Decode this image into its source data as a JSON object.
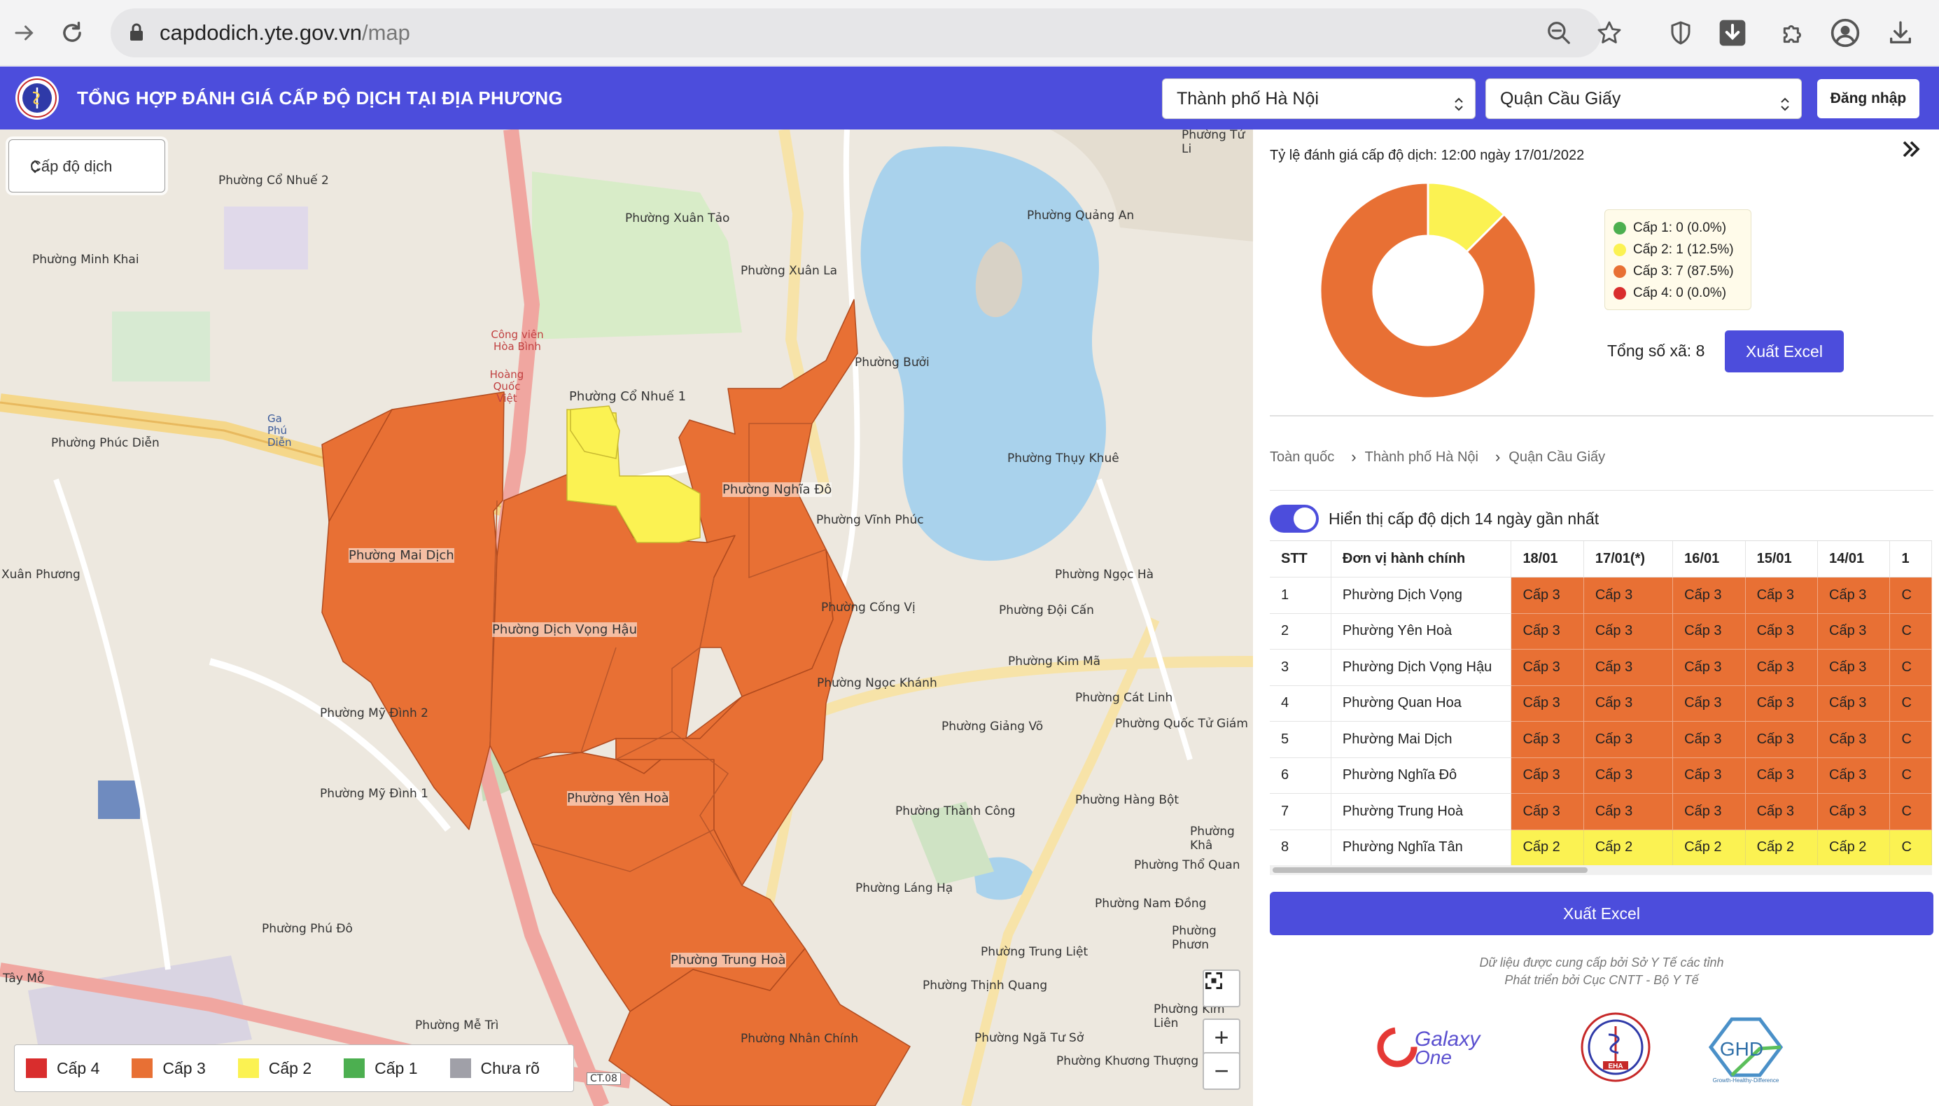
{
  "browser": {
    "url_host": "capdodich.yte.gov.vn",
    "url_path": "/map"
  },
  "header": {
    "title": "TỔNG HỢP ĐÁNH GIÁ CẤP ĐỘ DỊCH TẠI ĐỊA PHƯƠNG",
    "city_select": "Thành phố Hà Nội",
    "district_select": "Quận Cầu Giấy",
    "login_label": "Đăng nhập"
  },
  "map": {
    "level_select": "Cấp độ dịch",
    "legend": [
      {
        "label": "Cấp 4",
        "color": "#d92d2d"
      },
      {
        "label": "Cấp 3",
        "color": "#e87034"
      },
      {
        "label": "Cấp 2",
        "color": "#fbf252"
      },
      {
        "label": "Cấp 1",
        "color": "#4caf50"
      },
      {
        "label": "Chưa rõ",
        "color": "#a0a0a8"
      }
    ],
    "district_labels": [
      "Phường Mai Dịch",
      "Phường Dịch Vọng Hậu",
      "Phường Nghĩa Đô",
      "Phường Yên Hoà",
      "Phường Trung Hoà",
      "Phường Cổ Nhuế 1"
    ],
    "other_labels": [
      "Phường Cổ Nhuế 2",
      "Phường Xuân Tảo",
      "Phường Xuân La",
      "Phường Quảng An",
      "Phường Minh Khai",
      "Phường Bưởi",
      "Phường Thụy Khuê",
      "Phường Phúc Diễn",
      "Phường Vĩnh Phúc",
      "Xuân Phương",
      "Phường Ngọc Hà",
      "Phường Cống Vị",
      "Phường Đội Cấn",
      "Phường Kim Mã",
      "Phường Ngọc Khánh",
      "Phường Mỹ Đình 2",
      "Phường Cát Linh",
      "Phường Giảng Võ",
      "Phường Quốc Tử Giám",
      "Phường Mỹ Đình 1",
      "Phường Hàng Bột",
      "Phường Thành Công",
      "Phường Thổ Quan",
      "Phường Láng Hạ",
      "Phường Nam Đồng",
      "Phường Phú Đô",
      "Phường Trung Liệt",
      "Phường Thịnh Quang",
      "Tây Mỗ",
      "Phường Mễ Trì",
      "Phường Kim Liên",
      "Phường Nhân Chính",
      "Phường Ngã Tư Sở",
      "Phường Khương Thượng",
      "Phường Tứ Li",
      "Phường Khâ",
      "Phường Phươn",
      "Công viên Hòa Bình",
      "Hoàng Quốc Việt",
      "Ga Phú Diễn",
      "CT.08"
    ]
  },
  "panel": {
    "rate_title": "Tỷ lệ đánh giá cấp độ dịch: 12:00 ngày 17/01/2022",
    "pie": [
      {
        "label": "Cấp 1: 0 (0.0%)",
        "value": 0,
        "color": "#4caf50"
      },
      {
        "label": "Cấp 2: 1 (12.5%)",
        "value": 1,
        "color": "#fbf252"
      },
      {
        "label": "Cấp 3: 7 (87.5%)",
        "value": 7,
        "color": "#e87034"
      },
      {
        "label": "Cấp 4: 0 (0.0%)",
        "value": 0,
        "color": "#d92d2d"
      }
    ],
    "total_label": "Tổng số xã: 8",
    "export_label": "Xuất Excel",
    "breadcrumb": [
      "Toàn quốc",
      "Thành phố Hà Nội",
      "Quận Cầu Giấy"
    ],
    "toggle_label": "Hiển thị cấp độ dịch 14 ngày gần nhất",
    "toggle_on": true,
    "table": {
      "headers": [
        "STT",
        "Đơn vị hành chính",
        "18/01",
        "17/01(*)",
        "16/01",
        "15/01",
        "14/01",
        "1"
      ],
      "rows": [
        {
          "stt": "1",
          "name": "Phường Dịch Vọng",
          "levels": [
            "Cấp 3",
            "Cấp 3",
            "Cấp 3",
            "Cấp 3",
            "Cấp 3",
            "C"
          ]
        },
        {
          "stt": "2",
          "name": "Phường Yên Hoà",
          "levels": [
            "Cấp 3",
            "Cấp 3",
            "Cấp 3",
            "Cấp 3",
            "Cấp 3",
            "C"
          ]
        },
        {
          "stt": "3",
          "name": "Phường Dịch Vọng Hậu",
          "levels": [
            "Cấp 3",
            "Cấp 3",
            "Cấp 3",
            "Cấp 3",
            "Cấp 3",
            "C"
          ]
        },
        {
          "stt": "4",
          "name": "Phường Quan Hoa",
          "levels": [
            "Cấp 3",
            "Cấp 3",
            "Cấp 3",
            "Cấp 3",
            "Cấp 3",
            "C"
          ]
        },
        {
          "stt": "5",
          "name": "Phường Mai Dịch",
          "levels": [
            "Cấp 3",
            "Cấp 3",
            "Cấp 3",
            "Cấp 3",
            "Cấp 3",
            "C"
          ]
        },
        {
          "stt": "6",
          "name": "Phường Nghĩa Đô",
          "levels": [
            "Cấp 3",
            "Cấp 3",
            "Cấp 3",
            "Cấp 3",
            "Cấp 3",
            "C"
          ]
        },
        {
          "stt": "7",
          "name": "Phường Trung Hoà",
          "levels": [
            "Cấp 3",
            "Cấp 3",
            "Cấp 3",
            "Cấp 3",
            "Cấp 3",
            "C"
          ]
        },
        {
          "stt": "8",
          "name": "Phường Nghĩa Tân",
          "levels": [
            "Cấp 2",
            "Cấp 2",
            "Cấp 2",
            "Cấp 2",
            "Cấp 2",
            "C"
          ]
        }
      ]
    },
    "export_main_label": "Xuất Excel",
    "footer_line1": "Dữ liệu được cung cấp bởi Sở Y Tế các tỉnh",
    "footer_line2": "Phát triển bởi Cục CNTT - Bộ Y Tế",
    "partners": [
      "Galaxy",
      "One",
      "EHA",
      "GHD",
      "Growth-Healthy-Difference"
    ]
  },
  "colors": {
    "brand": "#4c4ddc",
    "level3": "#e87034",
    "level2": "#fbf252"
  }
}
